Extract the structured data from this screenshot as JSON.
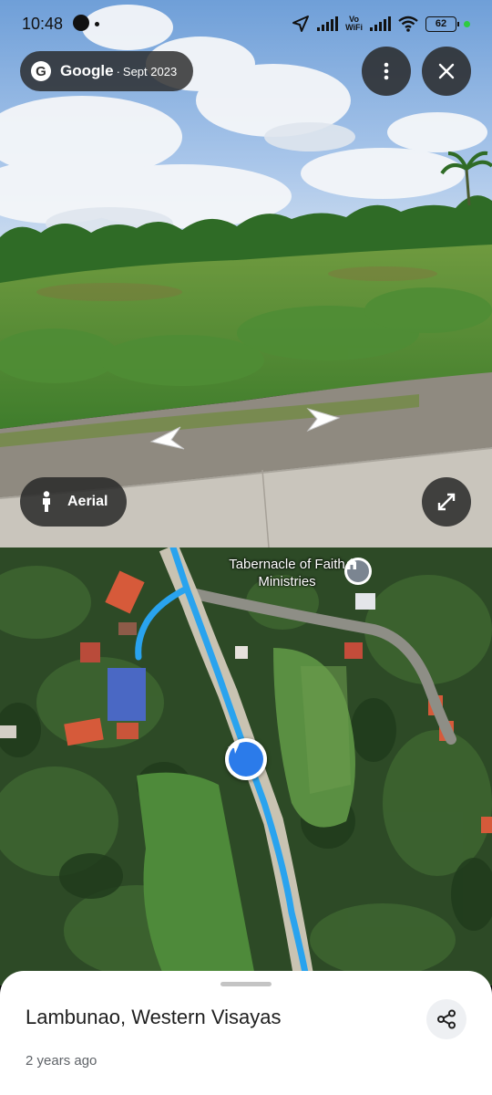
{
  "status_bar": {
    "time": "10:48",
    "vowifi": [
      "Vo",
      "WiFi"
    ],
    "battery": "62"
  },
  "streetview": {
    "brand": "Google",
    "separator": "·",
    "capture_date": "Sept 2023",
    "aerial_label": "Aerial",
    "icons": {
      "menu": "more-vertical-icon",
      "close": "close-icon",
      "aerial": "person-icon",
      "expand": "expand-icon",
      "nav_left": "left-arrow-icon",
      "nav_right": "right-arrow-icon"
    }
  },
  "map": {
    "poi_name": "Tabernacle of Faith Ministries",
    "route_color": "#29a3ee",
    "you_marker_color": "#2b7bea"
  },
  "sheet": {
    "place_name": "Lambunao, Western Visayas",
    "age": "2 years ago",
    "share_icon": "share-icon"
  }
}
